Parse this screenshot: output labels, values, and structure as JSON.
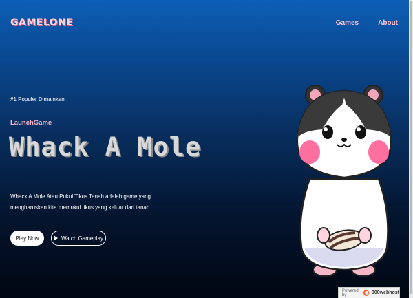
{
  "header": {
    "logo": "GAMELONE",
    "nav": [
      {
        "label": "Games"
      },
      {
        "label": "About"
      }
    ]
  },
  "hero": {
    "eyebrow": "#1 Populer Dimainkan",
    "subtitle": "LaunchGame",
    "title": "Whack A Mole",
    "description_line1": "Whack A Mole Atau Pukul Tikus Tanah adalah game yang",
    "description_line2": "mengharuskan kita memukul tikus yang keluar dari tanah",
    "play_button": "Play Now",
    "watch_button": "Watch Gameplay"
  },
  "badge": {
    "powered_by": "Powered by",
    "brand": "000webhost"
  },
  "colors": {
    "accent_pink": "#ffb8cb",
    "bg_top": "#0d5eb6",
    "bg_bottom": "#010712"
  }
}
